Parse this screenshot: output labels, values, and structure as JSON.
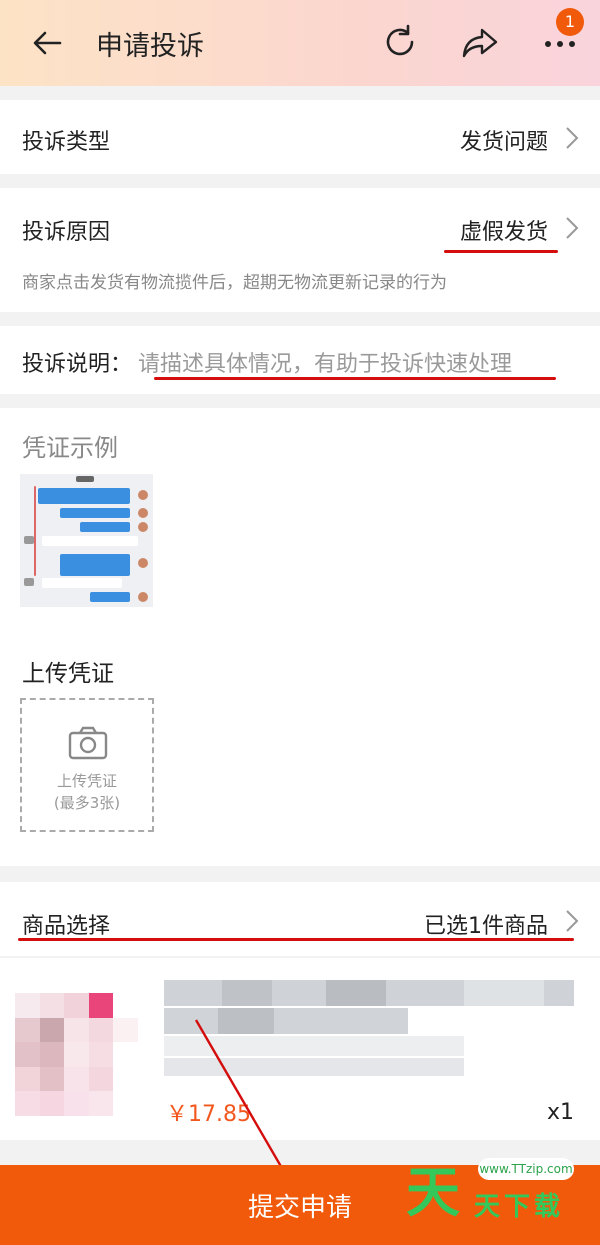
{
  "header": {
    "title": "申请投诉",
    "badge_count": "1"
  },
  "complaint_type": {
    "label": "投诉类型",
    "value": "发货问题"
  },
  "complaint_reason": {
    "label": "投诉原因",
    "value": "虚假发货",
    "description": "商家点击发货有物流揽件后，超期无物流更新记录的行为"
  },
  "complaint_note": {
    "label": "投诉说明：",
    "placeholder": "请描述具体情况，有助于投诉快速处理"
  },
  "evidence_example": {
    "title": "凭证示例"
  },
  "upload": {
    "title": "上传凭证",
    "box_label": "上传凭证",
    "box_limit": "(最多3张)"
  },
  "product_select": {
    "label": "商品选择",
    "value": "已选1件商品"
  },
  "product": {
    "price": "￥17.85",
    "quantity": "x1"
  },
  "footer": {
    "submit_label": "提交申请"
  },
  "watermark": {
    "url": "www.TTzip.com",
    "big": "天",
    "small": "天下载"
  },
  "colors": {
    "accent": "#f25a0b",
    "annotation": "#d40d0d",
    "price": "#f2581e"
  }
}
